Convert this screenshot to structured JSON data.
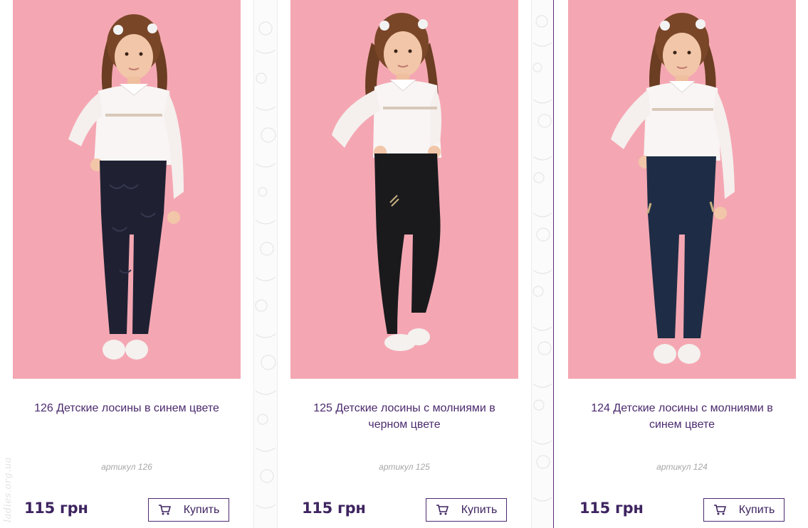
{
  "products": [
    {
      "title": "126 Детские лосины в синем цвете",
      "sku": "артикул 126",
      "price": "115 грн",
      "buy_label": "Купить",
      "image": "girl-in-white-blouse-dark-lace-leggings"
    },
    {
      "title": "125 Детские лосины с молниями в черном цвете",
      "sku": "артикул 125",
      "price": "115 грн",
      "buy_label": "Купить",
      "image": "girl-in-white-blouse-black-zip-leggings"
    },
    {
      "title": "124 Детские лосины с молниями в синем цвете",
      "sku": "артикул 124",
      "price": "115 грн",
      "buy_label": "Купить",
      "image": "girl-in-white-blouse-navy-zip-leggings"
    }
  ],
  "watermark": "ladies.org.ua",
  "colors": {
    "photo_background": "#f3a2ad",
    "accent": "#4b2a6e",
    "price": "#3e2460",
    "sku": "#a7a7a7",
    "legging_1": "#1f2133",
    "legging_2": "#1a1a1d",
    "legging_3": "#1f2c45"
  },
  "icons": {
    "buy": "cart-icon"
  }
}
